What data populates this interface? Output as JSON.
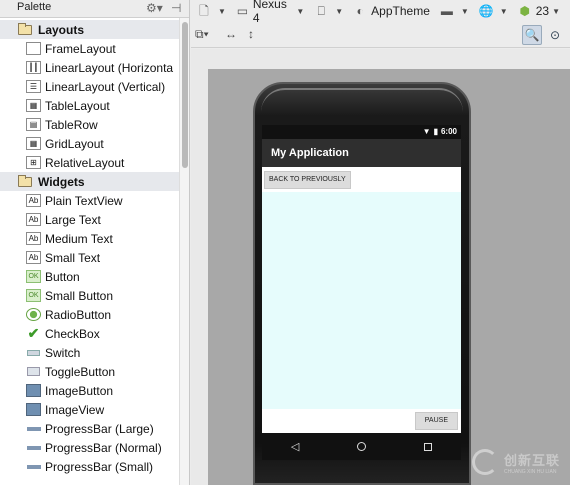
{
  "palette": {
    "title": "Palette",
    "groups": [
      {
        "label": "Layouts",
        "items": [
          "FrameLayout",
          "LinearLayout (Horizonta",
          "LinearLayout (Vertical)",
          "TableLayout",
          "TableRow",
          "GridLayout",
          "RelativeLayout"
        ]
      },
      {
        "label": "Widgets",
        "items": [
          "Plain TextView",
          "Large Text",
          "Medium Text",
          "Small Text",
          "Button",
          "Small Button",
          "RadioButton",
          "CheckBox",
          "Switch",
          "ToggleButton",
          "ImageButton",
          "ImageView",
          "ProgressBar (Large)",
          "ProgressBar (Normal)",
          "ProgressBar (Small)"
        ]
      }
    ],
    "icon_glyphs": {
      "ab": "Ab",
      "ok": "OK"
    }
  },
  "toolbar": {
    "device": "Nexus 4",
    "theme": "AppTheme",
    "api": "23"
  },
  "phone": {
    "time": "6:00",
    "app_title": "My Application",
    "back_button": "BACK TO PREVIOUSLY",
    "pause_button": "PAUSE"
  },
  "watermark": {
    "text": "创新互联",
    "sub": "CHUANG XIN HU LIAN"
  },
  "colors": {
    "content_bg": "#e6fcfc",
    "appbar": "#2f2f2f"
  }
}
